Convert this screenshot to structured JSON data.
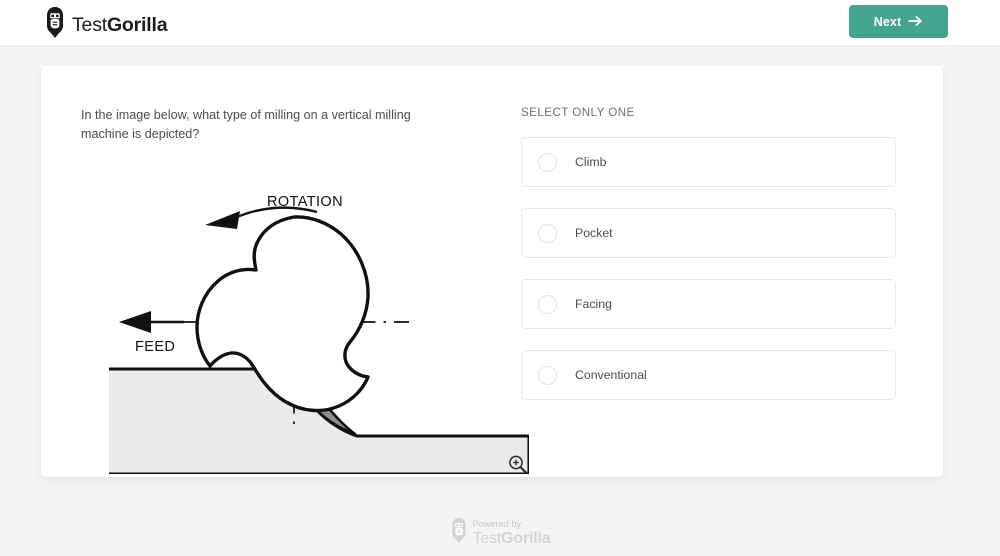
{
  "header": {
    "brand_light": "Test",
    "brand_bold": "Gorilla",
    "logo_icon": "gorilla-head-icon",
    "next_label": "Next",
    "next_icon": "arrow-right-icon",
    "next_color": "#43a492"
  },
  "question": {
    "text": "In the image below, what type of milling on a vertical milling machine is depicted?",
    "zoom_icon": "magnifier-plus-icon"
  },
  "figure": {
    "type": "technical-diagram",
    "subject": "vertical milling machine cutter engaging a workpiece",
    "rotation_label": "ROTATION",
    "feed_label": "FEED",
    "rotation_direction": "counterclockwise",
    "feed_direction": "left",
    "cutter_flutes": 3,
    "workpiece_fill": "#eaeaea",
    "chip_fill": "#8e8e8e",
    "line_color": "#000000"
  },
  "answers": {
    "instruction": "SELECT ONLY ONE",
    "selected": null,
    "options": [
      {
        "label": "Climb"
      },
      {
        "label": "Pocket"
      },
      {
        "label": "Facing"
      },
      {
        "label": "Conventional"
      }
    ]
  },
  "footer": {
    "powered_by": "Powered by",
    "brand_light": "Test",
    "brand_bold": "Gorilla",
    "logo_icon": "gorilla-head-icon"
  }
}
